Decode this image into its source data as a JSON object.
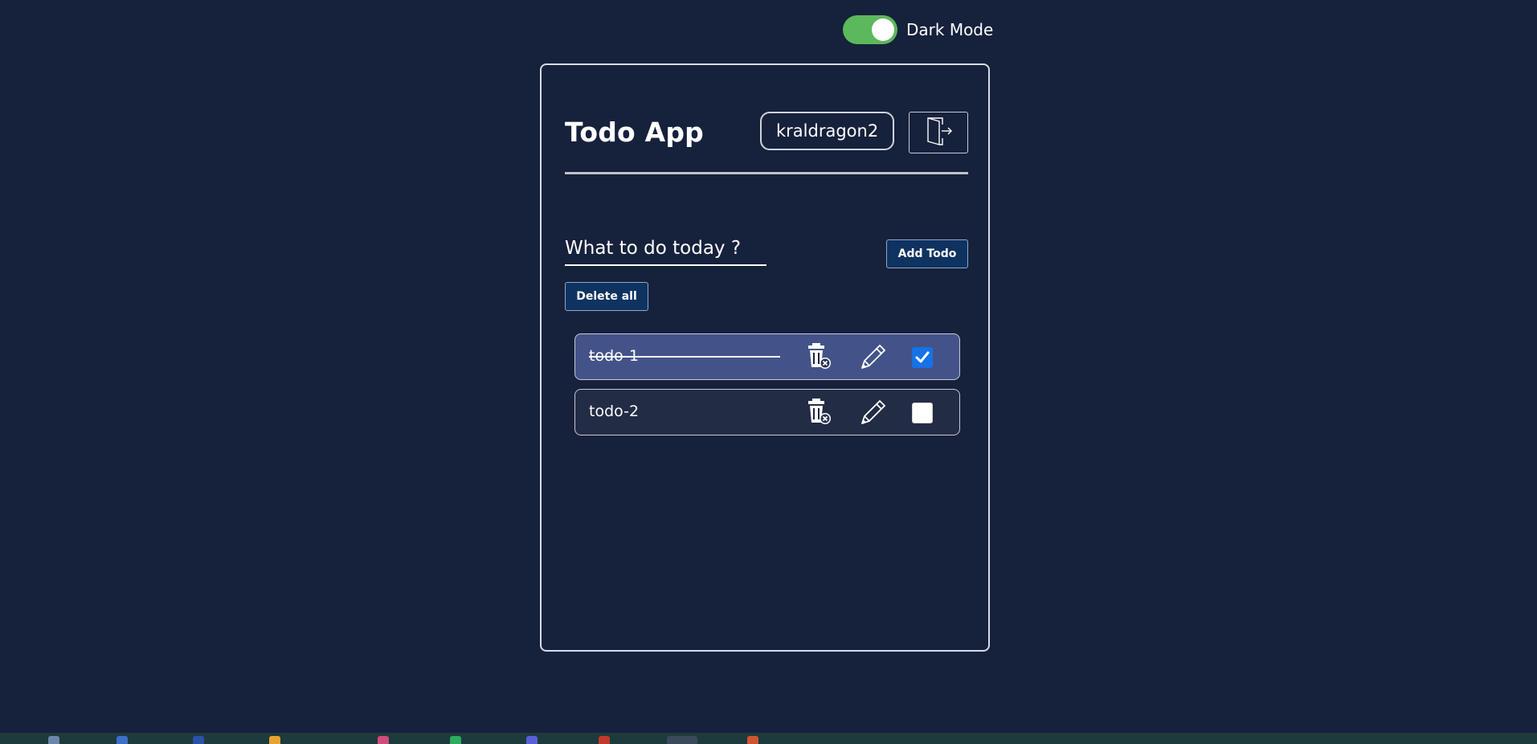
{
  "theme_toggle": {
    "label": "Dark Mode",
    "on": true,
    "color": "#5cb85c"
  },
  "header": {
    "title": "Todo App",
    "username": "kraldragon2",
    "logout_icon": "door-exit-icon"
  },
  "form": {
    "placeholder": "What to do today ?",
    "value": "",
    "add_label": "Add Todo",
    "delete_all_label": "Delete all"
  },
  "todos": [
    {
      "text": "todo-1",
      "completed": true
    },
    {
      "text": "todo-2",
      "completed": false
    }
  ],
  "icons": {
    "delete": "trash-delete-icon",
    "edit": "pencil-edit-icon"
  },
  "colors": {
    "background": "#16213c",
    "completed_item": "#43538a",
    "pending_item": "#232c45",
    "button": "#0f3360",
    "checkbox_checked": "#1672e6"
  }
}
